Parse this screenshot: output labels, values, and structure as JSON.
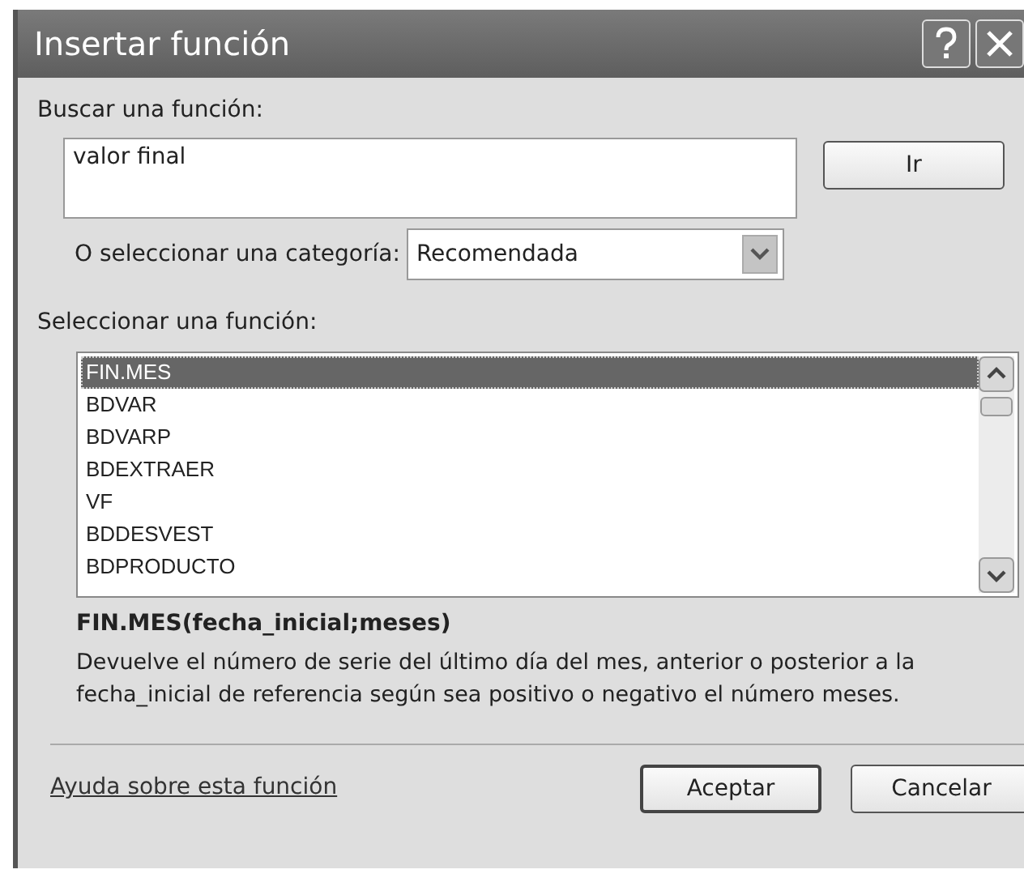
{
  "window": {
    "title": "Insertar función"
  },
  "search": {
    "label": "Buscar una función:",
    "value": "valor final",
    "button": "Ir"
  },
  "category": {
    "label": "O seleccionar una categoría:",
    "value": "Recomendada"
  },
  "functions": {
    "label": "Seleccionar una función:",
    "items": [
      {
        "name": "FIN.MES",
        "selected": true
      },
      {
        "name": "BDVAR",
        "selected": false
      },
      {
        "name": "BDVARP",
        "selected": false
      },
      {
        "name": "BDEXTRAER",
        "selected": false
      },
      {
        "name": "VF",
        "selected": false
      },
      {
        "name": "BDDESVEST",
        "selected": false
      },
      {
        "name": "BDPRODUCTO",
        "selected": false
      }
    ]
  },
  "signature": "FIN.MES(fecha_inicial;meses)",
  "description": "Devuelve el número de serie del último día del mes, anterior o posterior a la fecha_inicial de referencia según sea positivo o negativo el número meses.",
  "help_link": "Ayuda sobre esta función",
  "buttons": [
    "Aceptar",
    "Cancelar"
  ]
}
